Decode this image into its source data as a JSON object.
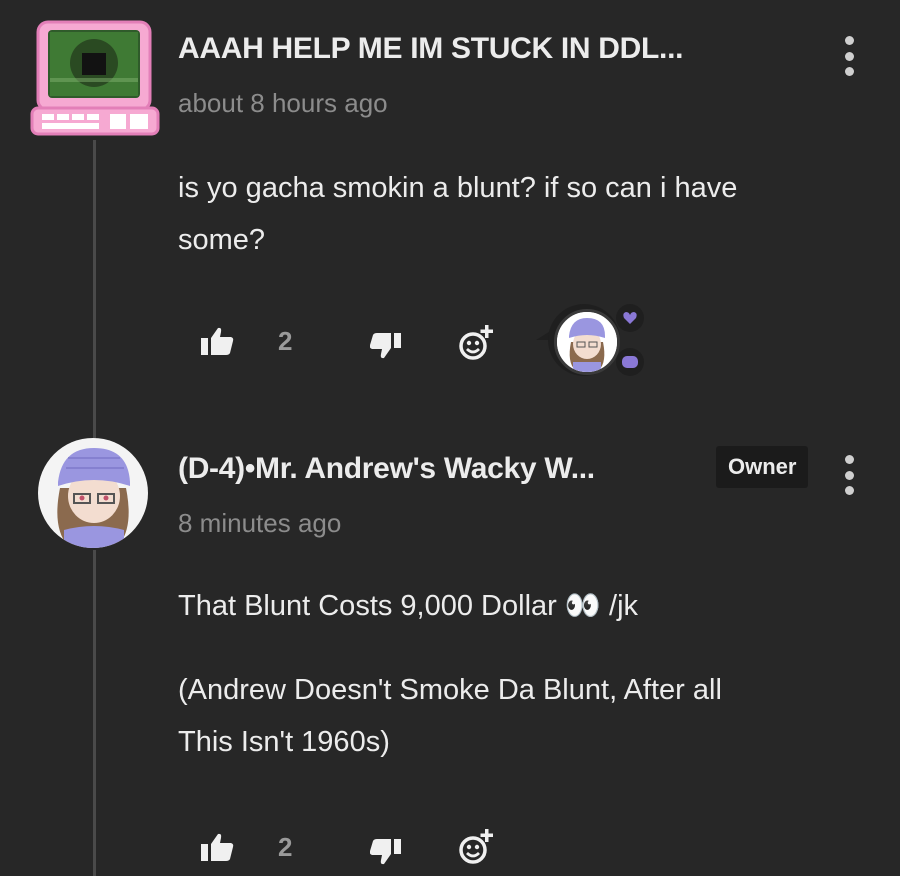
{
  "comments": [
    {
      "username": "AAAH HELP ME IM STUCK IN DDL...",
      "timestamp": "about 8 hours ago",
      "body": [
        "is yo gacha smokin a blunt? if so can i have",
        "some?"
      ],
      "likes": "2",
      "avatar_icon": "pink-computer-avatar"
    },
    {
      "username": "(D-4)•Mr. Andrew's Wacky W...",
      "badge": "Owner",
      "timestamp": "8 minutes ago",
      "body_line1": "That Blunt Costs 9,000 Dollar 👀 /jk",
      "body_para2": [
        "(Andrew Doesn't Smoke Da Blunt, After all",
        "This Isn't 1960s)"
      ],
      "likes": "2",
      "avatar_icon": "gacha-character-avatar"
    }
  ],
  "colors": {
    "background": "#272727",
    "text": "#ececec",
    "muted": "#8c8c8c",
    "accent_purple": "#8a78d6"
  }
}
